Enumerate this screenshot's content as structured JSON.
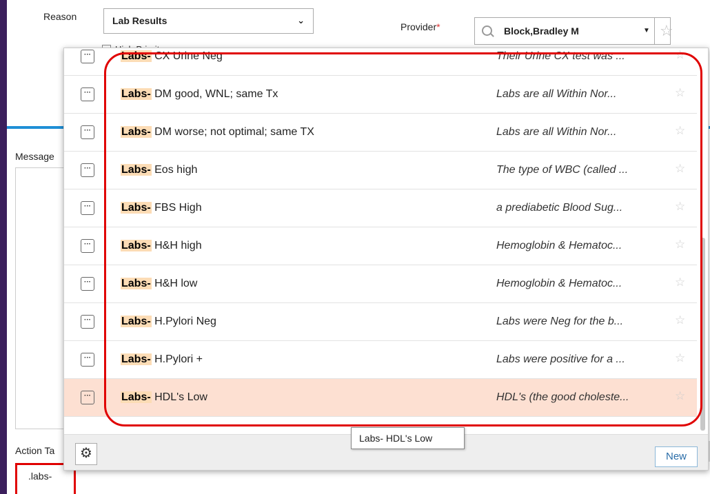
{
  "form": {
    "reason_label": "Reason",
    "reason_value": "Lab Results",
    "provider_label": "Provider",
    "required_mark": "*",
    "provider_value": "Block,Bradley M",
    "high_priority_label": "High Priority",
    "message_label": "Message",
    "action_label": "Action Ta",
    "action_input_value": ".labs-"
  },
  "dropdown": {
    "prefix": "Labs-",
    "items": [
      {
        "title": " CX Urine Neg",
        "desc": "Their Urine CX test was ..."
      },
      {
        "title": " DM good, WNL; same Tx",
        "desc": "Labs are all Within Nor..."
      },
      {
        "title": " DM worse; not optimal; same TX",
        "desc": "Labs are all Within Nor..."
      },
      {
        "title": " Eos high",
        "desc": "The type of WBC (called ..."
      },
      {
        "title": " FBS High",
        "desc": "a prediabetic Blood Sug..."
      },
      {
        "title": " H&H high",
        "desc": "Hemoglobin & Hematoc..."
      },
      {
        "title": " H&H low",
        "desc": "Hemoglobin & Hematoc..."
      },
      {
        "title": " H.Pylori Neg",
        "desc": "Labs were Neg for the b..."
      },
      {
        "title": " H.Pylori +",
        "desc": "Labs were positive for a ..."
      },
      {
        "title": " HDL's Low",
        "desc": "HDL's (the good choleste..."
      }
    ],
    "selected_index": 9,
    "tooltip": "Labs- HDL's Low",
    "new_button": "New",
    "more_glyph": "···",
    "star_glyph": "☆",
    "gear_glyph": "⚙",
    "chevron_glyph": "❯",
    "caret_glyph": "▼"
  },
  "colors": {
    "selected_row": "#fde0d2",
    "prefix_highlight": "#fcdcb5",
    "annotation": "#e00000",
    "accent": "#1f8fd6"
  }
}
